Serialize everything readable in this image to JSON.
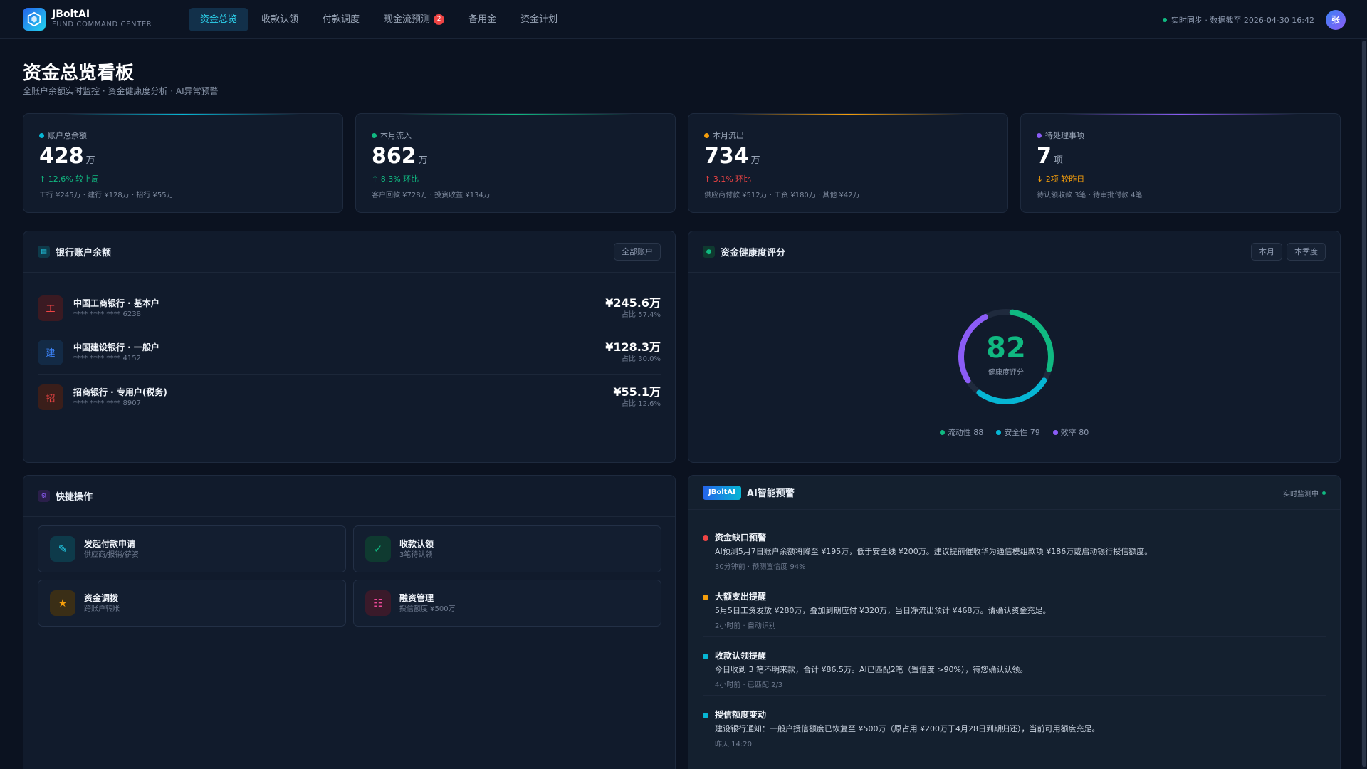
{
  "brand": {
    "name": "JBoltAI",
    "subtitle": "FUND COMMAND CENTER"
  },
  "nav": [
    {
      "label": "资金总览",
      "active": true
    },
    {
      "label": "收款认领"
    },
    {
      "label": "付款调度"
    },
    {
      "label": "现金流预测",
      "badge": "2"
    },
    {
      "label": "备用金"
    },
    {
      "label": "资金计划"
    }
  ],
  "topright": {
    "sync_text": "实时同步 · 数据截至 2026-04-30 16:42",
    "avatar": "张"
  },
  "page": {
    "title": "资金总览看板",
    "subtitle": "全账户余额实时监控 · 资金健康度分析 · AI异常预警"
  },
  "stats": [
    {
      "label": "账户总余额",
      "value": "428",
      "unit": "万",
      "change": "↑ 12.6% 较上周",
      "detail": "工行 ¥245万 · 建行 ¥128万 · 招行 ¥55万",
      "color": "#06b6d4",
      "change_color": "#10b981"
    },
    {
      "label": "本月流入",
      "value": "862",
      "unit": "万",
      "change": "↑ 8.3% 环比",
      "detail": "客户回款 ¥728万 · 投资收益 ¥134万",
      "color": "#10b981",
      "change_color": "#10b981"
    },
    {
      "label": "本月流出",
      "value": "734",
      "unit": "万",
      "change": "↑ 3.1% 环比",
      "detail": "供应商付款 ¥512万 · 工资 ¥180万 · 其他 ¥42万",
      "color": "#f59e0b",
      "change_color": "#ef4444"
    },
    {
      "label": "待处理事项",
      "value": "7",
      "unit": "项",
      "change": "↓ 2项 较昨日",
      "detail": "待认领收款 3笔 · 待审批付款 4笔",
      "color": "#8b5cf6",
      "change_color": "#f59e0b"
    }
  ],
  "bank_panel": {
    "title": "银行账户余额",
    "button": "全部账户",
    "accounts": [
      {
        "icon": "工",
        "name": "中国工商银行 · 基本户",
        "account": "**** **** **** 6238",
        "amount": "¥245.6万",
        "share": "占比 57.4%"
      },
      {
        "icon": "建",
        "name": "中国建设银行 · 一般户",
        "account": "**** **** **** 4152",
        "amount": "¥128.3万",
        "share": "占比 30.0%"
      },
      {
        "icon": "招",
        "name": "招商银行 · 专用户(税务)",
        "account": "**** **** **** 8907",
        "amount": "¥55.1万",
        "share": "占比 12.6%"
      }
    ]
  },
  "health_panel": {
    "title": "资金健康度评分",
    "buttons": [
      "本月",
      "本季度"
    ],
    "score": "82",
    "score_label": "健康度评分",
    "legend": [
      {
        "label": "流动性 88",
        "color": "#10b981"
      },
      {
        "label": "安全性 79",
        "color": "#06b6d4"
      },
      {
        "label": "效率 80",
        "color": "#8b5cf6"
      }
    ]
  },
  "quick_panel": {
    "title": "快捷操作",
    "actions": [
      {
        "icon": "✎",
        "title": "发起付款申请",
        "sub": "供应商/报销/薪资"
      },
      {
        "icon": "✓",
        "title": "收款认领",
        "sub": "3笔待认领"
      },
      {
        "icon": "★",
        "title": "资金调拨",
        "sub": "跨账户转账"
      },
      {
        "icon": "☷",
        "title": "融资管理",
        "sub": "授信额度 ¥500万"
      }
    ]
  },
  "ai_panel": {
    "tag": "JBoltAI",
    "title": "AI智能预警",
    "status": "实时监测中",
    "alerts": [
      {
        "title": "资金缺口预警",
        "body": "AI预测5月7日账户余额将降至 ¥195万，低于安全线 ¥200万。建议提前催收华为通信模组款项 ¥186万或启动银行授信额度。",
        "meta": "30分钟前 · 预测置信度 94%",
        "color": "#ef4444"
      },
      {
        "title": "大额支出提醒",
        "body": "5月5日工资发放 ¥280万，叠加到期应付 ¥320万，当日净流出预计 ¥468万。请确认资金充足。",
        "meta": "2小时前 · 自动识别",
        "color": "#f59e0b"
      },
      {
        "title": "收款认领提醒",
        "body": "今日收到 3 笔不明来款，合计 ¥86.5万。AI已匹配2笔（置信度 >90%），待您确认认领。",
        "meta": "4小时前 · 已匹配 2/3",
        "color": "#06b6d4"
      },
      {
        "title": "授信额度变动",
        "body": "建设银行通知：一般户授信额度已恢复至 ¥500万（原占用 ¥200万于4月28日到期归还），当前可用额度充足。",
        "meta": "昨天 14:20",
        "color": "#06b6d4"
      }
    ]
  }
}
